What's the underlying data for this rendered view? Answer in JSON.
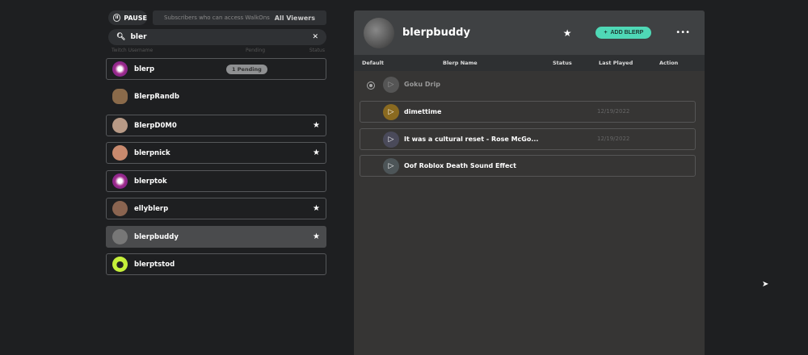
{
  "top": {
    "pause_label": "PAUSE",
    "subscribers_label": "Subscribers who can access WalkOns",
    "subscribers_value": "All Viewers"
  },
  "search": {
    "value": "bler"
  },
  "columns": {
    "username": "Twitch Username",
    "pending": "Pending",
    "status": "Status"
  },
  "users": [
    {
      "name": "blerp",
      "pending": "1 Pending",
      "starred": false
    },
    {
      "name": "BlerpRandb",
      "starred": false
    },
    {
      "name": "BlerpD0M0",
      "starred": true
    },
    {
      "name": "blerpnick",
      "starred": true
    },
    {
      "name": "blerptok",
      "starred": false
    },
    {
      "name": "ellyblerp",
      "starred": true
    },
    {
      "name": "blerpbuddy",
      "starred": true,
      "selected": true
    },
    {
      "name": "blerptstod",
      "starred": false
    }
  ],
  "panel": {
    "name": "blerpbuddy",
    "add_label": "ADD BLERP",
    "more": "•••",
    "headers": {
      "default": "Default",
      "name": "Blerp Name",
      "status": "Status",
      "last_played": "Last Played",
      "action": "Action"
    },
    "blerps": [
      {
        "name": "Goku Drip",
        "last_played": "",
        "default": true
      },
      {
        "name": "dimettime",
        "last_played": "12/19/2022"
      },
      {
        "name": "It was a cultural reset - Rose McGo...",
        "last_played": "12/19/2022"
      },
      {
        "name": "Oof Roblox Death Sound Effect",
        "last_played": ""
      }
    ]
  },
  "colors": {
    "accent": "#4fd8b6"
  }
}
